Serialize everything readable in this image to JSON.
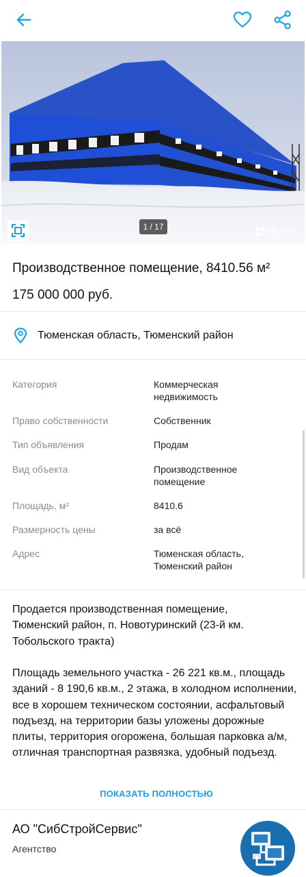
{
  "topbar": {
    "back_icon": "arrow-left-icon",
    "favorite_icon": "heart-outline-icon",
    "share_icon": "share-icon",
    "accent_color": "#1aa3e8"
  },
  "gallery": {
    "counter": "1 / 17",
    "watermark": "Avito",
    "fullscreen_icon": "expand-frame-icon"
  },
  "listing": {
    "title": "Производственное помещение, 8410.56 м²",
    "price": "175 000 000 руб.",
    "location": "Тюменская область, Тюменский район",
    "location_icon": "map-pin-icon"
  },
  "params": [
    {
      "label": "Категория",
      "value": "Коммерческая недвижимость"
    },
    {
      "label": "Право собственности",
      "value": "Собственник"
    },
    {
      "label": "Тип объявления",
      "value": "Продам"
    },
    {
      "label": "Вид объекта",
      "value": "Производственное помещение"
    },
    {
      "label": "Площадь, м²",
      "value": "8410.6"
    },
    {
      "label": "Размерность цены",
      "value": "за всё"
    },
    {
      "label": "Адрес",
      "value": "Тюменская область, Тюменский район"
    }
  ],
  "description": {
    "paragraph_1": "Продается производственная помещение, Тюменский район, п. Новотуринский (23-й км. Тобольского тракта)",
    "paragraph_2": "Площадь земельного участка - 26 221 кв.м., площадь зданий - 8 190,6 кв.м., 2 этажа, в холодном исполнении, все в хорошем техническом состоянии, асфальтовый подъезд, на территории базы уложены дорожные плиты, территория огорожена, большая парковка а/м, отличная транспортная развязка, удобный подъезд.",
    "show_more": "ПОКАЗАТЬ ПОЛНОСТЬЮ"
  },
  "seller": {
    "name": "АО \"СибСтройСервис\"",
    "type": "Агентство",
    "logo_icon": "company-logo"
  }
}
